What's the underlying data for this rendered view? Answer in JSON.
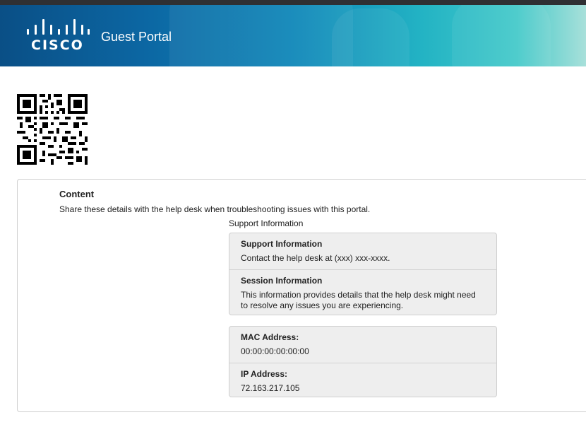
{
  "header": {
    "brand": "CISCO",
    "title": "Guest Portal",
    "logo_icon": "cisco-logo-icon",
    "colors": {
      "start": "#0a4f86",
      "end": "#a8e0da"
    }
  },
  "qr": {
    "icon": "qr-code-icon"
  },
  "content": {
    "title": "Content",
    "description": "Share these details with the help desk when troubleshooting issues with this portal.",
    "support_label": "Support Information",
    "panel1": {
      "support_title": "Support Information",
      "support_body": "Contact the help desk at (xxx) xxx-xxxx.",
      "session_title": "Session Information",
      "session_body": "This information provides details that the help desk might need to resolve any issues you are experiencing."
    },
    "panel2": {
      "mac_label": "MAC Address:",
      "mac_value": "00:00:00:00:00:00",
      "ip_label": "IP Address:",
      "ip_value": "72.163.217.105"
    }
  }
}
